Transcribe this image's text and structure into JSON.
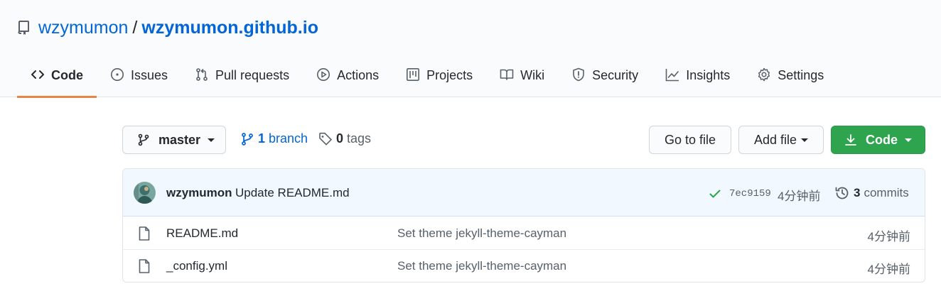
{
  "repo": {
    "owner": "wzymumon",
    "separator": "/",
    "name": "wzymumon.github.io"
  },
  "tabs": [
    {
      "label": "Code",
      "icon": "code-icon",
      "selected": true
    },
    {
      "label": "Issues",
      "icon": "issue-opened-icon"
    },
    {
      "label": "Pull requests",
      "icon": "git-pull-request-icon"
    },
    {
      "label": "Actions",
      "icon": "play-icon"
    },
    {
      "label": "Projects",
      "icon": "project-icon"
    },
    {
      "label": "Wiki",
      "icon": "book-icon"
    },
    {
      "label": "Security",
      "icon": "shield-icon"
    },
    {
      "label": "Insights",
      "icon": "graph-icon"
    },
    {
      "label": "Settings",
      "icon": "gear-icon"
    }
  ],
  "toolbar": {
    "branch": "master",
    "branch_count": "1",
    "branch_label": "branch",
    "tag_count": "0",
    "tag_label": "tags",
    "go_to_file": "Go to file",
    "add_file": "Add file",
    "code": "Code"
  },
  "latest_commit": {
    "author": "wzymumon",
    "message": "Update README.md",
    "sha": "7ec9159",
    "age": "4分钟前",
    "commit_count": "3",
    "commit_label": "commits"
  },
  "files": [
    {
      "name": "README.md",
      "message": "Set theme jekyll-theme-cayman",
      "age": "4分钟前",
      "icon": "file-icon"
    },
    {
      "name": "_config.yml",
      "message": "Set theme jekyll-theme-cayman",
      "age": "4分钟前",
      "icon": "file-icon"
    }
  ],
  "colors": {
    "link": "#0366d6",
    "primary_button": "#2ea44f",
    "selected_tab_underline": "#e36209",
    "commit_bar": "#f1f8ff",
    "success": "#28a745"
  }
}
